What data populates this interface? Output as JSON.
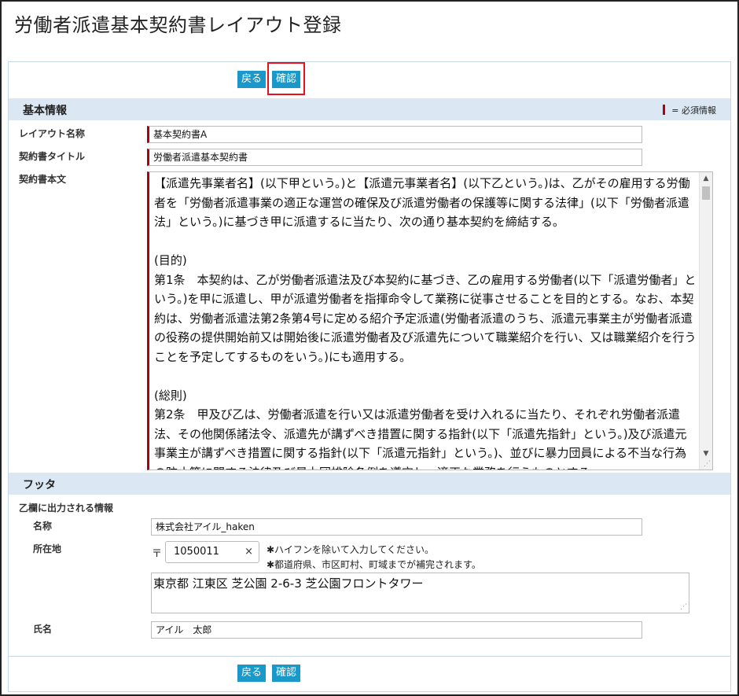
{
  "page": {
    "title": "労働者派遣基本契約書レイアウト登録"
  },
  "buttons": {
    "back": "戻る",
    "confirm": "確認"
  },
  "basic_info": {
    "section_title": "基本情報",
    "required_legend": "= 必須情報",
    "layout_name_label": "レイアウト名称",
    "layout_name_value": "基本契約書A",
    "contract_title_label": "契約書タイトル",
    "contract_title_value": "労働者派遣基本契約書",
    "contract_body_label": "契約書本文",
    "contract_body_value": "【派遣先事業者名】(以下甲という。)と【派遣元事業者名】(以下乙という。)は、乙がその雇用する労働者を「労働者派遣事業の適正な運営の確保及び派遣労働者の保護等に関する法律」(以下「労働者派遣法」という。)に基づき甲に派遣するに当たり、次の通り基本契約を締結する。\n\n(目的)\n第1条　本契約は、乙が労働者派遣法及び本契約に基づき、乙の雇用する労働者(以下「派遣労働者」という。)を甲に派遣し、甲が派遣労働者を指揮命令して業務に従事させることを目的とする。なお、本契約は、労働者派遣法第2条第4号に定める紹介予定派遣(労働者派遣のうち、派遣元事業主が労働者派遣の役務の提供開始前又は開始後に派遣労働者及び派遣先について職業紹介を行い、又は職業紹介を行うことを予定してするものをいう。)にも適用する。\n\n(総則)\n第2条　甲及び乙は、労働者派遣を行い又は派遣労働者を受け入れるに当たり、それぞれ労働者派遣法、その他関係諸法令、派遣先が講ずべき措置に関する指針(以下「派遣先指針」という。)及び派遣元事業主が講ずべき措置に関する指針(以下「派遣元指針」という。)、並びに暴力団員による不当な行為の防止等に関する法律及び暴力団排除条例を遵守し、適正な業務を行うものとする。"
  },
  "footer": {
    "section_title": "フッタ",
    "otsu_label": "乙欄に出力される情報",
    "name_label": "名称",
    "name_value": "株式会社アイル_haken",
    "address_label": "所在地",
    "postal_mark": "〒",
    "postal_value": "1050011",
    "postal_clear": "×",
    "note_1": "✱ハイフンを除いて入力してください。",
    "note_2": "✱都道府県、市区町村、町域までが補完されます。",
    "address_value": "東京都 江東区 芝公園 2-6-3 芝公園フロントタワー",
    "person_label": "氏名",
    "person_value": "アイル　太郎"
  },
  "colors": {
    "button": "#1a98c9",
    "section_bar": "#dbe7f3",
    "required": "#b00010",
    "highlight": "#e8101c"
  }
}
